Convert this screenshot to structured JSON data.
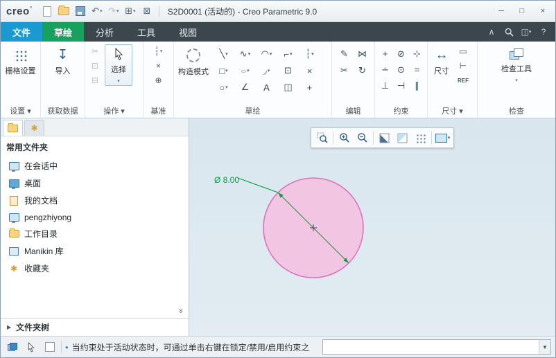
{
  "colors": {
    "file_tab_blue": "#1b9ad2",
    "sketch_tab_green": "#17a05e",
    "ribbon_dark_bar": "#3c464d",
    "canvas_background": "#dce8f0",
    "circle_fill": "#f2c6e2",
    "circle_stroke": "#dd70c0",
    "dimension_green": "#00a33c",
    "accent_blue": "#2f7cb6"
  },
  "titlebar": {
    "logo": "creo",
    "logo_mark": "°",
    "title": "S2D0001 (活动的) - Creo Parametric 9.0"
  },
  "tabs": {
    "file": "文件",
    "sketch": "草绘",
    "analysis": "分析",
    "tools": "工具",
    "view": "视图"
  },
  "ribbon": {
    "setup": {
      "label": "设置 ▾",
      "grid_button": "栅格设置"
    },
    "get_data": {
      "label": "获取数据",
      "import_button": "导入"
    },
    "operations": {
      "label": "操作 ▾",
      "select_button": "选择"
    },
    "datum": {
      "label": "基准"
    },
    "sketch": {
      "label": "草绘",
      "construction_button": "构造模式"
    },
    "edit": {
      "label": "编辑"
    },
    "constrain": {
      "label": "约束"
    },
    "dimension": {
      "label": "尺寸 ▾",
      "dim_button": "尺寸"
    },
    "inspect": {
      "label": "检查",
      "inspect_button": "检查工具"
    }
  },
  "icons": {
    "caret": "▾",
    "caret_big": "▼",
    "tri_right": "▶",
    "undo": "↶",
    "redo": "↷",
    "window": "⊞",
    "close_window": "⊠",
    "minimize": "─",
    "maximize": "□",
    "close": "×",
    "collapse_ribbon": "∧",
    "switch_display": "◫",
    "help": "?",
    "import": "↧",
    "cut": "✂",
    "copy": "⊡",
    "paste": "⊟",
    "datum_centerline": "┆",
    "datum_point": "×",
    "datum_csys": "⊕",
    "line": "╲",
    "spline": "∿",
    "arc": "◠",
    "conic": "⌐",
    "centerline": "┆",
    "rect": "□",
    "ellipse": "○",
    "fillet": "◞",
    "offset": "⊡",
    "delete": "×",
    "circle": "○",
    "chamfer": "∠",
    "text": "A",
    "palette": "◫",
    "point": "+",
    "mirror": "⋈",
    "modify": "✎",
    "divide": "✂",
    "rotate": "↻",
    "c_vertical": "+",
    "c_tangent": "⊘",
    "c_horizontal": "⊹",
    "c_midpoint": "∸",
    "c_coincident": "⊙",
    "c_equal": "=",
    "c_perpendicular": "⊥",
    "c_symmetric": "⊣",
    "c_parallel": "∥",
    "dim_arrow": "↔",
    "dim_perimeter": "▭",
    "dim_baseline": "⊢",
    "dim_ref": "REF",
    "chevrons": "»",
    "bullet": "•",
    "asterisk": "✱"
  },
  "sidebar": {
    "header": "常用文件夹",
    "items": [
      {
        "label": "在会话中"
      },
      {
        "label": "桌面"
      },
      {
        "label": "我的文档"
      },
      {
        "label": "pengzhiyong"
      },
      {
        "label": "工作目录"
      },
      {
        "label": "Manikin 库"
      },
      {
        "label": "收藏夹"
      }
    ],
    "folder_tree": "文件夹树"
  },
  "canvas": {
    "dimension_label": "Ø 8.00",
    "circle_fill": "#f2c6e2",
    "circle_stroke": "#dd70c0",
    "dim_color": "#00a33c"
  },
  "statusbar": {
    "message": "当约束处于活动状态时，可通过单击右键在锁定/禁用/启用约束之",
    "filter_value": ""
  }
}
